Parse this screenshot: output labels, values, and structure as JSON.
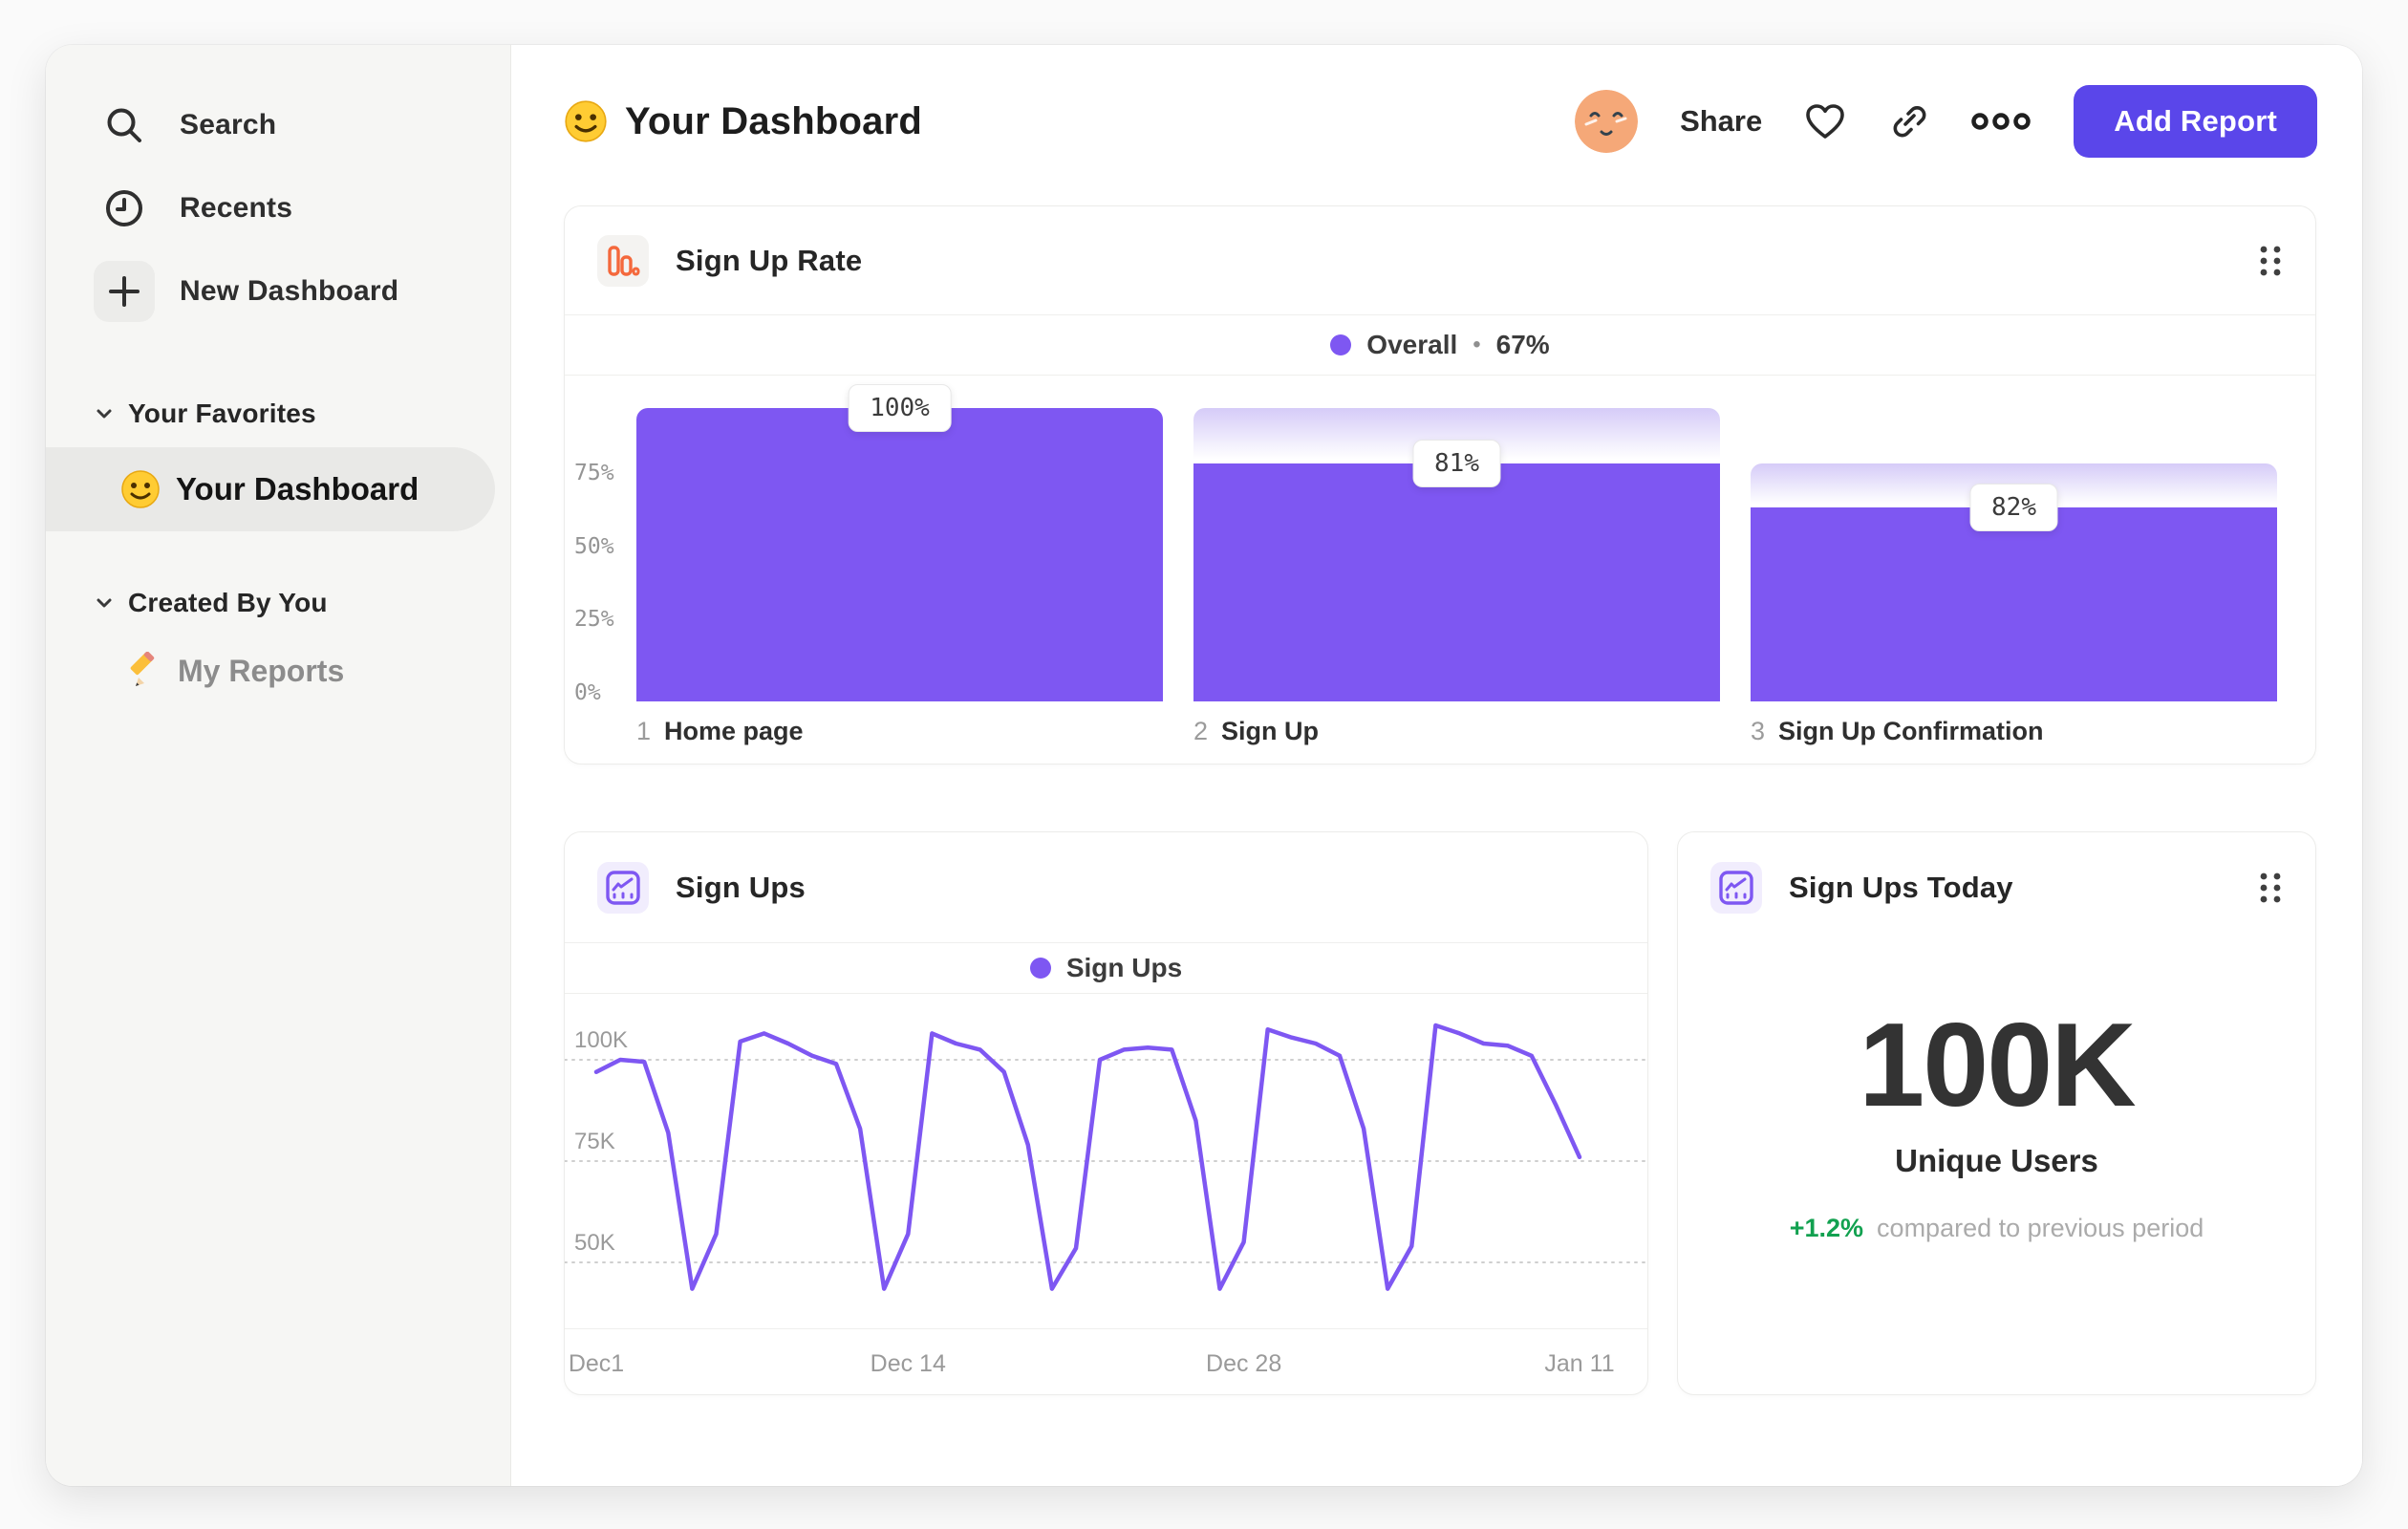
{
  "colors": {
    "accent_purple": "#7e57f2",
    "cap_gradient_top": "#d5cbf8",
    "button_purple": "#5a46ea",
    "positive_green": "#12a150",
    "funnel_icon_orange": "#f4683c",
    "sidebar_bg": "#f6f6f4",
    "selected_pill_bg": "#e9e9e7"
  },
  "sidebar": {
    "items": [
      {
        "label": "Search",
        "icon": "search-icon"
      },
      {
        "label": "Recents",
        "icon": "clock-icon"
      },
      {
        "label": "New Dashboard",
        "icon": "plus-icon"
      }
    ],
    "sections": [
      {
        "title": "Your Favorites"
      },
      {
        "title": "Created By You"
      }
    ],
    "favorite_item": {
      "label": "Your Dashboard",
      "icon": "smiley-emoji",
      "selected": true
    },
    "created_item": {
      "label": "My Reports",
      "icon": "pencil-emoji",
      "selected": false
    }
  },
  "header": {
    "title": "Your Dashboard",
    "title_icon": "smiley-emoji",
    "share_label": "Share",
    "add_report_label": "Add Report"
  },
  "cards": {
    "funnel": {
      "title": "Sign Up Rate",
      "legend_series": "Overall",
      "legend_separator": "•",
      "legend_value": "67%"
    },
    "line": {
      "title": "Sign Ups",
      "legend_series": "Sign Ups"
    },
    "metric": {
      "title": "Sign Ups Today",
      "value": "100K",
      "label": "Unique Users",
      "delta": "+1.2%",
      "delta_note": "compared to previous period"
    }
  },
  "chart_data": [
    {
      "type": "bar",
      "subtype": "funnel",
      "title": "Sign Up Rate",
      "legend": "Overall",
      "overall_conversion": "67%",
      "categories": [
        "Home page",
        "Sign Up",
        "Sign Up Confirmation"
      ],
      "step_numbers": [
        "1",
        "2",
        "3"
      ],
      "value_labels": [
        "100%",
        "81%",
        "82%"
      ],
      "values": [
        100,
        81,
        82
      ],
      "cumulative": [
        100,
        81,
        66
      ],
      "y_ticks": [
        {
          "label": "75%",
          "value": 75
        },
        {
          "label": "50%",
          "value": 50
        },
        {
          "label": "25%",
          "value": 25
        },
        {
          "label": "0%",
          "value": 0
        }
      ],
      "ylim": [
        0,
        100
      ],
      "grid": false,
      "legend_position": "top-center",
      "bar_color": "#7e57f2"
    },
    {
      "type": "line",
      "title": "Sign Ups",
      "legend": "Sign Ups",
      "unit": "K",
      "x_ticks": [
        {
          "label": "Dec1",
          "day": 0
        },
        {
          "label": "Dec 14",
          "day": 13
        },
        {
          "label": "Dec 28",
          "day": 27
        },
        {
          "label": "Jan 11",
          "day": 41
        }
      ],
      "y_ticks": [
        {
          "label": "100K",
          "value": 100
        },
        {
          "label": "75K",
          "value": 75
        },
        {
          "label": "50K",
          "value": 50
        }
      ],
      "ylim": [
        35,
        115
      ],
      "grid": "dotted-horizontal",
      "legend_position": "top-center",
      "line_color": "#7e57f2",
      "values": [
        97,
        100,
        99.5,
        82,
        43.5,
        57,
        104.5,
        106.5,
        104,
        101,
        99,
        83,
        43.5,
        57,
        106.5,
        104,
        102.5,
        97,
        79,
        43.5,
        53.5,
        100,
        102.5,
        103,
        102.5,
        85,
        43.5,
        55,
        107.5,
        105.5,
        104,
        101,
        83,
        43.5,
        54,
        108.5,
        106.5,
        104,
        103.5,
        101,
        89,
        76
      ]
    },
    {
      "type": "table",
      "title": "Sign Ups Today",
      "metric_value": "100K",
      "metric_label": "Unique Users",
      "delta": "+1.2%",
      "delta_note": "compared to previous period"
    }
  ]
}
